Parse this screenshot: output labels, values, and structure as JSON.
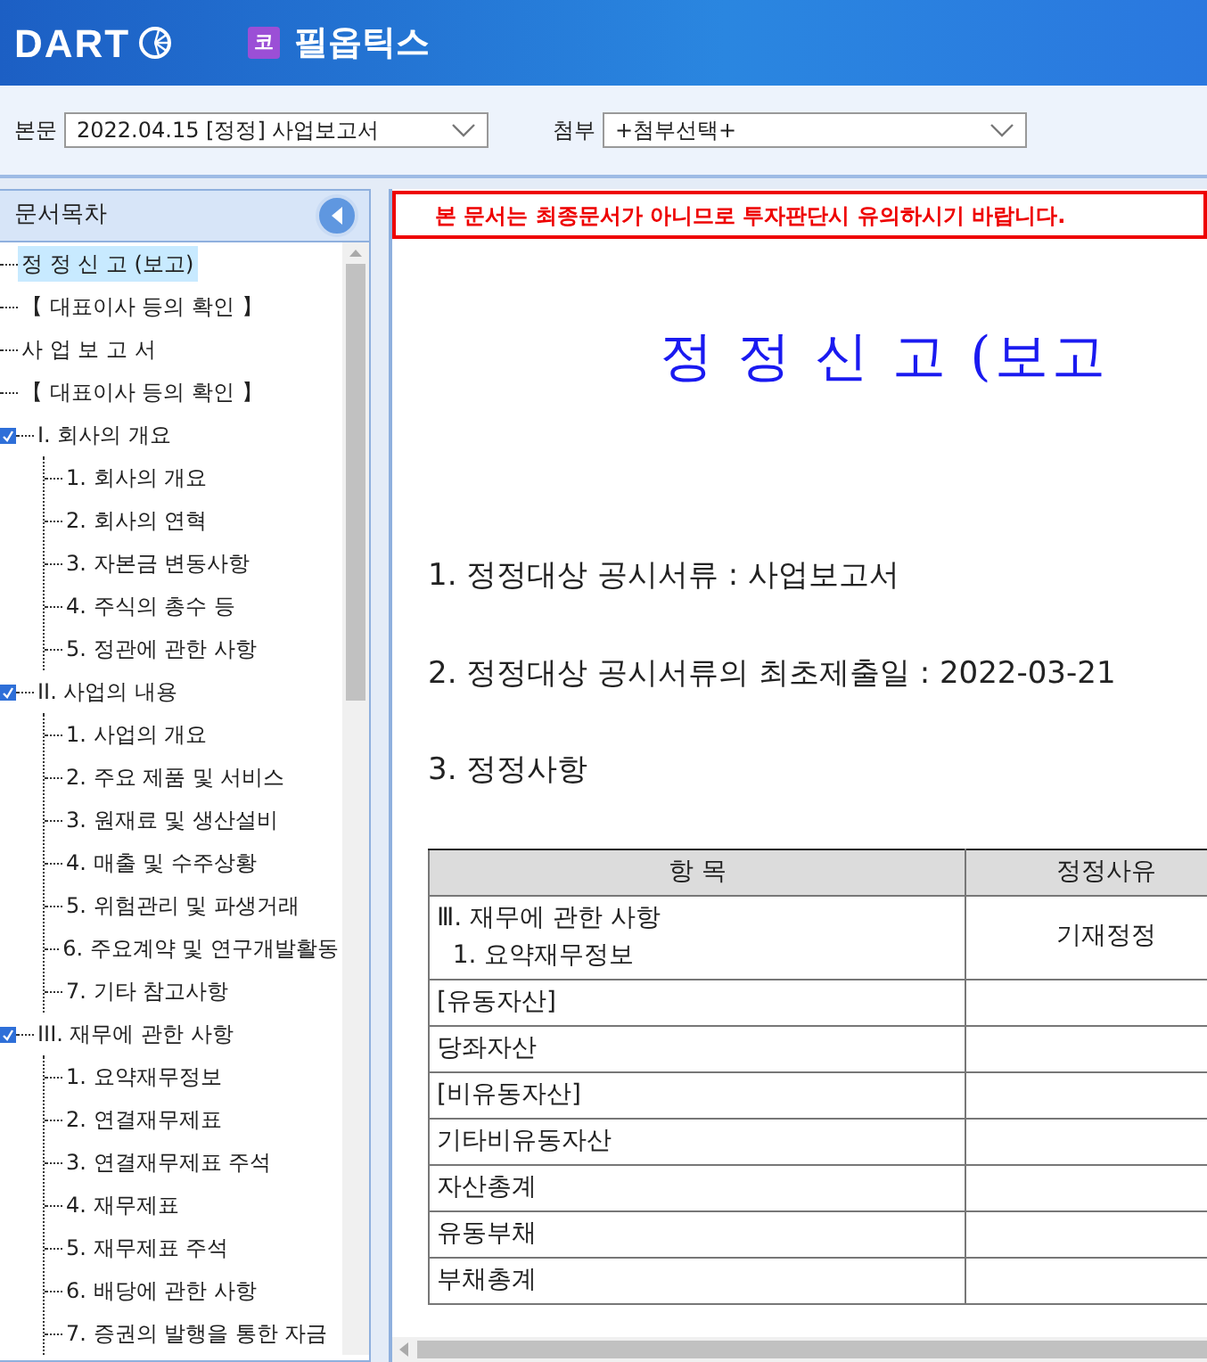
{
  "header": {
    "logo": "DART",
    "company_badge": "코",
    "company": "필옵틱스"
  },
  "toolbar": {
    "body_label": "본문",
    "body_select": "2022.04.15 [정정] 사업보고서",
    "attach_label": "첨부",
    "attach_select": "+첨부선택+"
  },
  "sidebar": {
    "title": "문서목차",
    "items": [
      {
        "label": "정 정 신 고 (보고)",
        "selected": true,
        "expanded": false
      },
      {
        "label": "【 대표이사 등의 확인 】",
        "selected": false,
        "expanded": false
      },
      {
        "label": "사 업 보 고 서",
        "selected": false,
        "expanded": false
      },
      {
        "label": "【 대표이사 등의 확인 】",
        "selected": false,
        "expanded": false
      },
      {
        "label": "I. 회사의 개요",
        "selected": false,
        "expanded": true,
        "children": [
          {
            "label": "1. 회사의 개요",
            "selected": false
          },
          {
            "label": "2. 회사의 연혁",
            "selected": false
          },
          {
            "label": "3. 자본금 변동사항",
            "selected": false
          },
          {
            "label": "4. 주식의 총수 등",
            "selected": false
          },
          {
            "label": "5. 정관에 관한 사항",
            "selected": false
          }
        ]
      },
      {
        "label": "II. 사업의 내용",
        "selected": false,
        "expanded": true,
        "children": [
          {
            "label": "1. 사업의 개요",
            "selected": false
          },
          {
            "label": "2. 주요 제품 및 서비스",
            "selected": false
          },
          {
            "label": "3. 원재료 및 생산설비",
            "selected": false
          },
          {
            "label": "4. 매출 및 수주상황",
            "selected": false
          },
          {
            "label": "5. 위험관리 및 파생거래",
            "selected": false
          },
          {
            "label": "6. 주요계약 및 연구개발활동",
            "selected": false
          },
          {
            "label": "7. 기타 참고사항",
            "selected": false
          }
        ]
      },
      {
        "label": "III. 재무에 관한 사항",
        "selected": false,
        "expanded": true,
        "children": [
          {
            "label": "1. 요약재무정보",
            "selected": false
          },
          {
            "label": "2. 연결재무제표",
            "selected": false
          },
          {
            "label": "3. 연결재무제표 주석",
            "selected": false
          },
          {
            "label": "4. 재무제표",
            "selected": false
          },
          {
            "label": "5. 재무제표 주석",
            "selected": false
          },
          {
            "label": "6. 배당에 관한 사항",
            "selected": false
          },
          {
            "label": "7. 증권의 발행을 통한 자금",
            "selected": false
          }
        ]
      }
    ]
  },
  "document": {
    "notice": "본 문서는 최종문서가 아니므로 투자판단시 유의하시기 바랍니다.",
    "title": "정 정 신 고 (보고",
    "sections": [
      "1. 정정대상 공시서류 : 사업보고서",
      "2. 정정대상 공시서류의 최초제출일 : 2022-03-21",
      "3. 정정사항"
    ],
    "table": {
      "columns": [
        "항 목",
        "정정사유"
      ],
      "rows": [
        {
          "item": [
            "Ⅲ. 재무에 관한 사항",
            "  1. 요약재무정보"
          ],
          "reason": "기재정정"
        },
        {
          "item": [
            "[유동자산]"
          ]
        },
        {
          "item": [
            "당좌자산"
          ]
        },
        {
          "item": [
            "[비유동자산]"
          ]
        },
        {
          "item": [
            "기타비유동자산"
          ]
        },
        {
          "item": [
            "자산총계"
          ]
        },
        {
          "item": [
            "유동부채"
          ]
        },
        {
          "item": [
            "부채총계"
          ]
        }
      ]
    }
  }
}
